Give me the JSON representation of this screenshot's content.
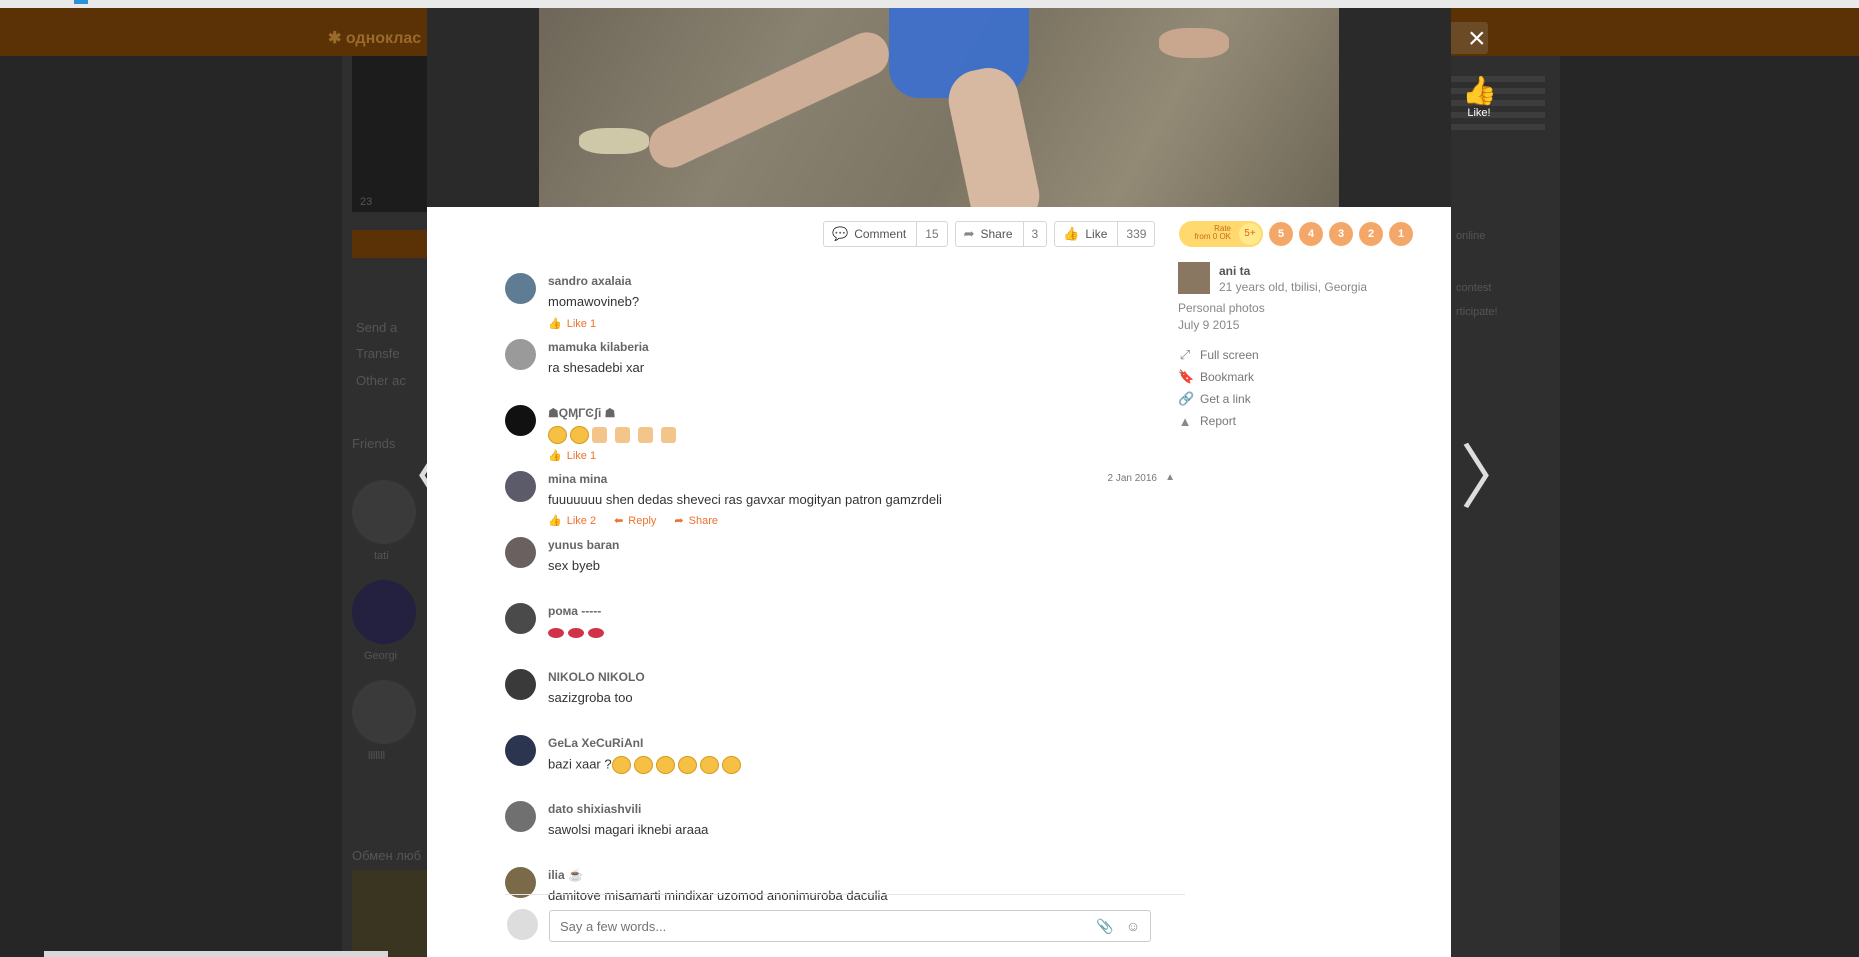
{
  "background": {
    "logo": "одноклас",
    "thumb_counts": "23",
    "menu": [
      "Send a",
      "Transfe",
      "Other ac"
    ],
    "friends_title": "Friends",
    "friends": [
      "tati",
      "Georgi",
      "lllllll"
    ],
    "ad_title": "Обмен люб",
    "right_panel": "online",
    "contest": "contest",
    "participate": "rticipate!"
  },
  "photo_actions": {
    "comment_label": "Comment",
    "comment_count": "15",
    "share_label": "Share",
    "share_count": "3",
    "like_label": "Like",
    "like_count": "339"
  },
  "comments": [
    {
      "name": "sandro axalaia",
      "text": "momawovineb?",
      "like": "Like 1"
    },
    {
      "name": "mamuka kilaberia",
      "text": "ra shesadebi xar"
    },
    {
      "name": "☗QӍΓϾʃi ☗",
      "text": "",
      "like": "Like 1"
    },
    {
      "name": "mina mina",
      "text": "fuuuuuuu shen dedas sheveci ras gavxar mogityan patron gamzrdeli",
      "date": "2 Jan 2016",
      "like": "Like 2",
      "reply": "Reply",
      "share": "Share"
    },
    {
      "name": "yunus baran",
      "text": "sex byeb"
    },
    {
      "name": "рома -----",
      "text": ""
    },
    {
      "name": "NIKOLO NIKOLO",
      "text": "sazizgroba too"
    },
    {
      "name": "GeLa XeCuRiAnI",
      "text": "bazi xaar ?"
    },
    {
      "name": "dato shixiashvili",
      "text": "sawolsi magari iknebi  araaa"
    },
    {
      "name": "ilia",
      "text": "damitove misamarti mindixar uzomod anonimuroba daculia"
    }
  ],
  "comment_input": {
    "placeholder": "Say a few words..."
  },
  "rating": {
    "label_line1": "Rate",
    "label_line2": "from 0 OK",
    "plus": "5+",
    "stars": [
      "5",
      "4",
      "3",
      "2",
      "1"
    ]
  },
  "owner": {
    "name": "ani ta",
    "info": "21 years old, tbilisi, Georgia",
    "album": "Personal photos",
    "date": "July 9 2015"
  },
  "side_links": [
    "Full screen",
    "Bookmark",
    "Get a link",
    "Report"
  ],
  "overlay": {
    "close": "×",
    "like_label": "Like!",
    "prev": "〈",
    "next": "〉"
  },
  "colors": {
    "accent": "#eb722e",
    "rate_pill": "#ffd96e",
    "star": "#f3a86a"
  }
}
